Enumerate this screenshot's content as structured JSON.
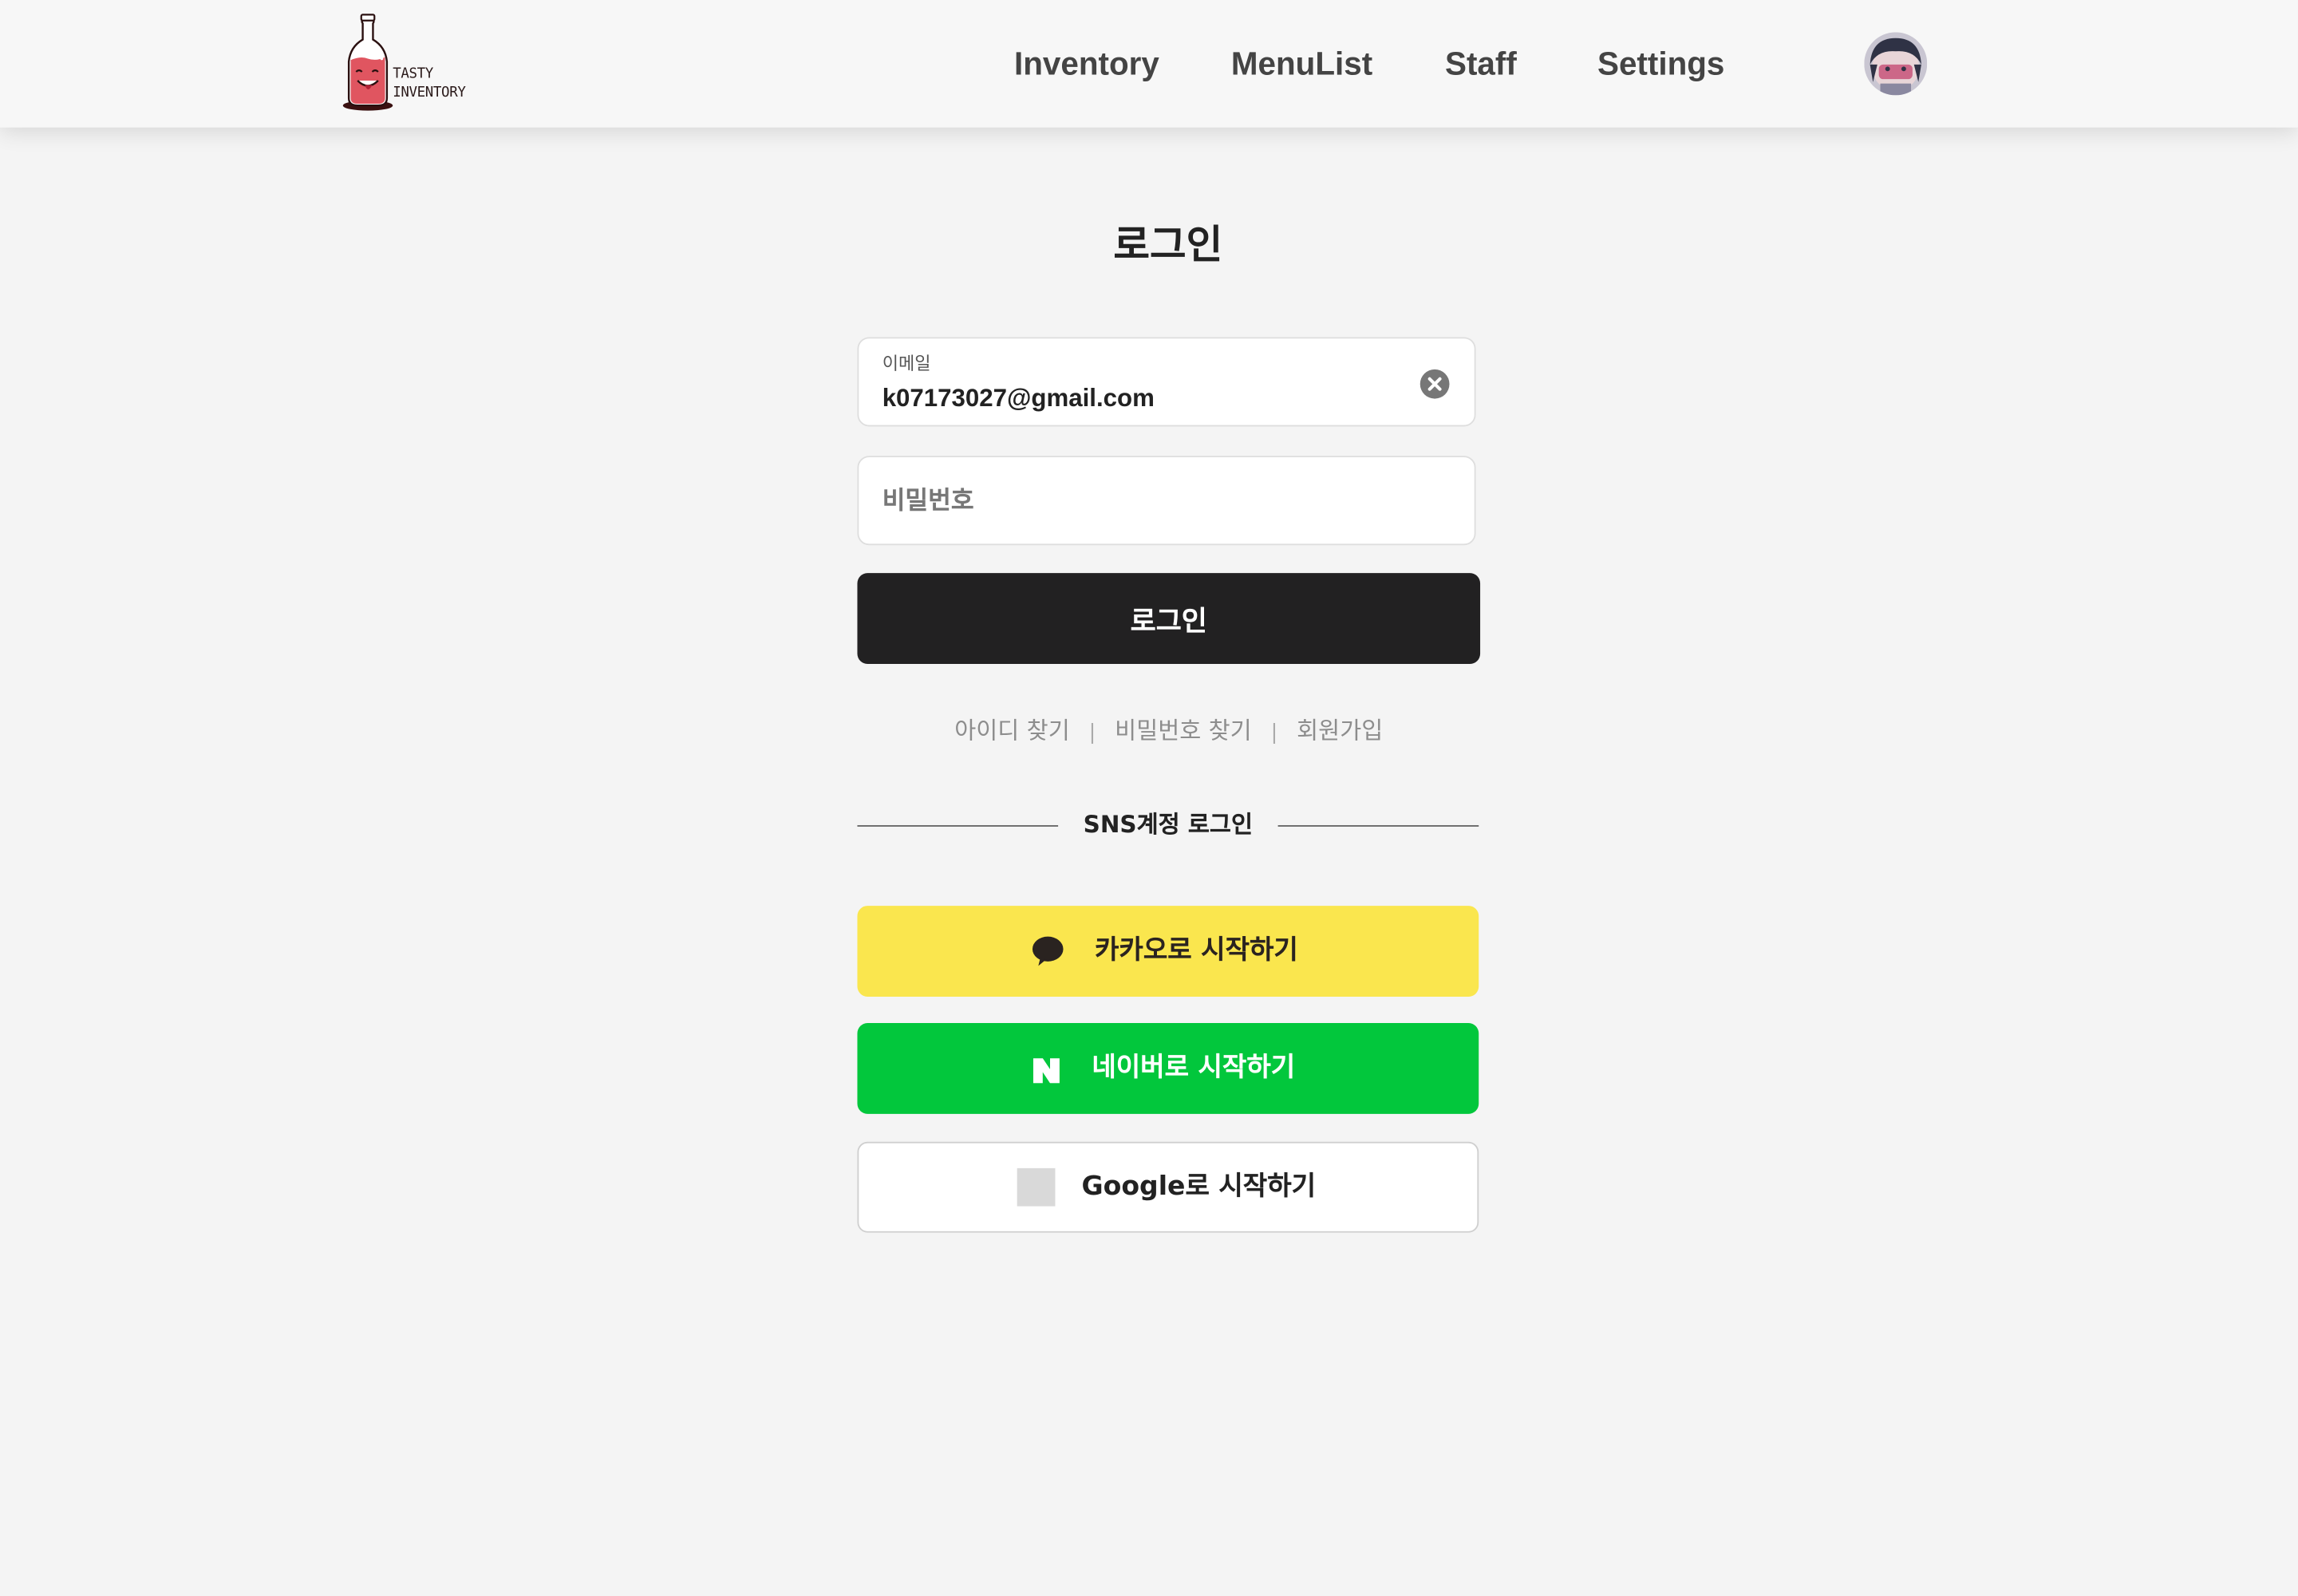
{
  "header": {
    "logo": {
      "line1": "TASTY",
      "line2": "INVENTORY"
    },
    "nav": [
      {
        "label": "Inventory"
      },
      {
        "label": "MenuList"
      },
      {
        "label": "Staff"
      },
      {
        "label": "Settings"
      }
    ]
  },
  "login": {
    "title": "로그인",
    "email": {
      "label": "이메일",
      "value": "k07173027@gmail.com"
    },
    "password": {
      "placeholder": "비밀번호"
    },
    "submit_label": "로그인",
    "links": {
      "find_id": "아이디 찾기",
      "find_password": "비밀번호 찾기",
      "signup": "회원가입",
      "separator": "|"
    },
    "sns_divider": "SNS계정 로그인",
    "sns": {
      "kakao": {
        "label": "카카오로 시작하기",
        "icon": "kakao-chat-icon",
        "color": "#fae64e"
      },
      "naver": {
        "label": "네이버로 시작하기",
        "icon": "naver-n-icon",
        "color": "#02c73c"
      },
      "google": {
        "label": "Google로 시작하기",
        "icon": "google-icon-placeholder",
        "color": "#ffffff"
      }
    }
  },
  "colors": {
    "background": "#f4f4f4",
    "primary_button": "#222122",
    "link_text": "#8d8d8d",
    "logo_bottle": "#e05560"
  }
}
